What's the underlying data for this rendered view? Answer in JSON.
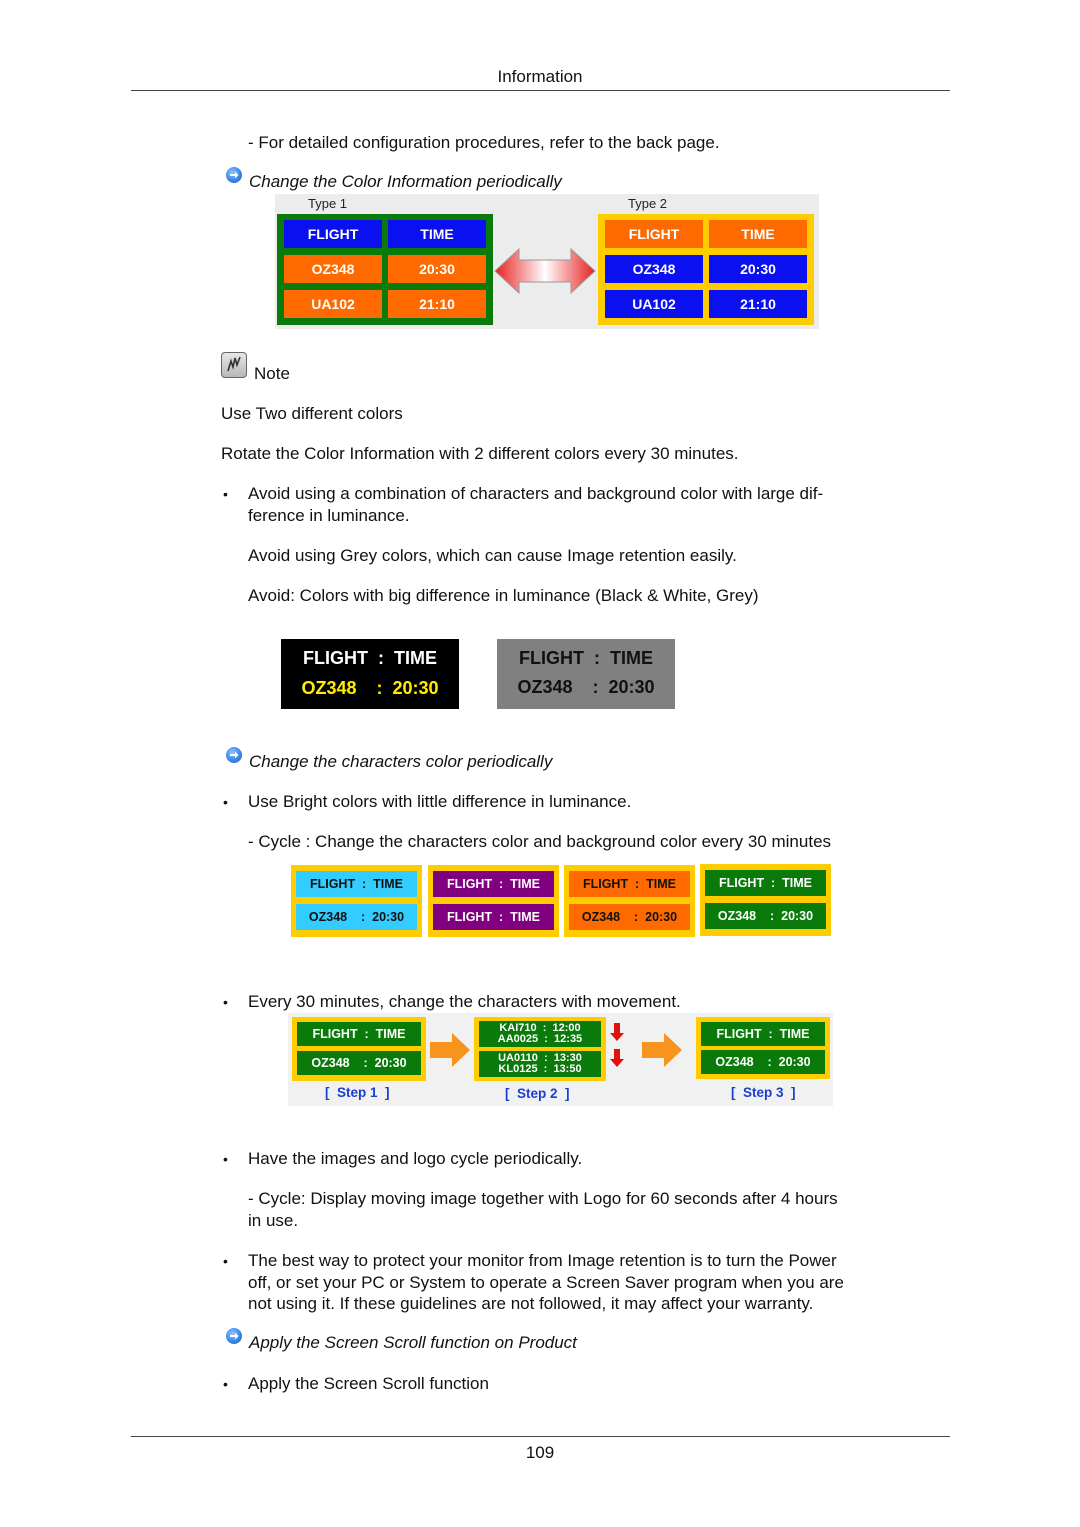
{
  "header": {
    "title": "Information"
  },
  "paragraphs": {
    "config_note": "- For detailed configuration procedures, refer to the back page.",
    "section1_title": "Change the Color Information periodically",
    "note_label": "Note",
    "use_two_colors": "Use Two different colors",
    "rotate": "Rotate the Color Information with 2 different colors every 30 minutes.",
    "avoid_combo_line1": "Avoid using a combination of characters and background color with large dif-",
    "avoid_combo_line2": "ference in luminance.",
    "avoid_grey": "Avoid using Grey colors, which can cause Image retention easily.",
    "avoid_colors": "Avoid: Colors with big difference in luminance (Black & White, Grey)",
    "section2_title": "Change the characters color periodically",
    "use_bright": "Use Bright colors with little difference in luminance.",
    "cycle_chars": "- Cycle : Change the characters color and background color every 30 minutes",
    "every30": "Every 30 minutes, change the characters with movement.",
    "images_logo": "Have the images and logo cycle periodically.",
    "cycle_logo_line1": "- Cycle: Display moving image together with Logo for 60 seconds after 4 hours",
    "cycle_logo_line2": "in use.",
    "best_way_line1": "The best way to protect your monitor from Image retention is to turn the Power",
    "best_way_line2": "off, or set your PC or System to operate a Screen Saver program when you are",
    "best_way_line3": "not using it. If these guidelines are not followed, it may affect your warranty.",
    "section3_title": "Apply the Screen Scroll function on Product",
    "apply_scroll": "Apply the Screen Scroll function",
    "bullet": "•"
  },
  "figure_types": {
    "type1_label": "Type 1",
    "type2_label": "Type 2",
    "type1": {
      "frame_color": "#0a7a0a",
      "cells": [
        {
          "text": "FLIGHT",
          "bg": "#0a10f0"
        },
        {
          "text": "TIME",
          "bg": "#0a10f0"
        },
        {
          "text": "OZ348",
          "bg": "#ff6a00"
        },
        {
          "text": "20:30",
          "bg": "#ff6a00"
        },
        {
          "text": "UA102",
          "bg": "#ff6a00"
        },
        {
          "text": "21:10",
          "bg": "#ff6a00"
        }
      ]
    },
    "type2": {
      "frame_color": "#ffcc00",
      "cells": [
        {
          "text": "FLIGHT",
          "bg": "#ff6a00"
        },
        {
          "text": "TIME",
          "bg": "#ff6a00"
        },
        {
          "text": "OZ348",
          "bg": "#0a10f0"
        },
        {
          "text": "20:30",
          "bg": "#0a10f0"
        },
        {
          "text": "UA102",
          "bg": "#0a10f0"
        },
        {
          "text": "21:10",
          "bg": "#0a10f0"
        }
      ]
    }
  },
  "figure_avoid": {
    "dark": {
      "line1": "FLIGHT  :  TIME",
      "line2": "OZ348    :  20:30",
      "bg": "#000000",
      "line1_color": "#ffffff",
      "line2_color": "#ffee00"
    },
    "grey": {
      "line1": "FLIGHT  :  TIME",
      "line2": "OZ348    :  20:30",
      "bg": "#808080",
      "line1_color": "#111111",
      "line2_color": "#111111"
    }
  },
  "figure_cycle": {
    "frame_color": "#ffcc00",
    "boards": [
      {
        "bg": "#33ccff",
        "fg": "#111111",
        "line1": "FLIGHT  :  TIME",
        "line2": "OZ348    :  20:30"
      },
      {
        "bg": "#800080",
        "fg": "#ffffff",
        "line1": "FLIGHT  :  TIME",
        "line2": "FLIGHT  :  TIME"
      },
      {
        "bg": "#ff6a00",
        "fg": "#111111",
        "line1": "FLIGHT  :  TIME",
        "line2": "OZ348    :  20:30"
      },
      {
        "bg": "#0a7a0a",
        "fg": "#ffffff",
        "line1": "FLIGHT  :  TIME",
        "line2": "OZ348    :  20:30"
      }
    ]
  },
  "figure_steps": {
    "step1": {
      "line1": "FLIGHT  :  TIME",
      "line2": "OZ348    :  20:30",
      "label": "[  Step 1  ]"
    },
    "step2": {
      "top_a": "KAI710  :  12:00",
      "top_b": "AA0025  :  12:35",
      "bot_a": "UA0110  :  13:30",
      "bot_b": "KL0125  :  13:50",
      "label": "[  Step 2  ]"
    },
    "step3": {
      "line1": "FLIGHT  :  TIME",
      "line2": "OZ348    :  20:30",
      "label": "[  Step 3  ]"
    },
    "board_bg": "#0a7a0a",
    "frame_color": "#ffcc00",
    "arrow_color": "#f7941d",
    "down_arrow_color": "#e01010"
  },
  "footer": {
    "page_number": "109"
  }
}
